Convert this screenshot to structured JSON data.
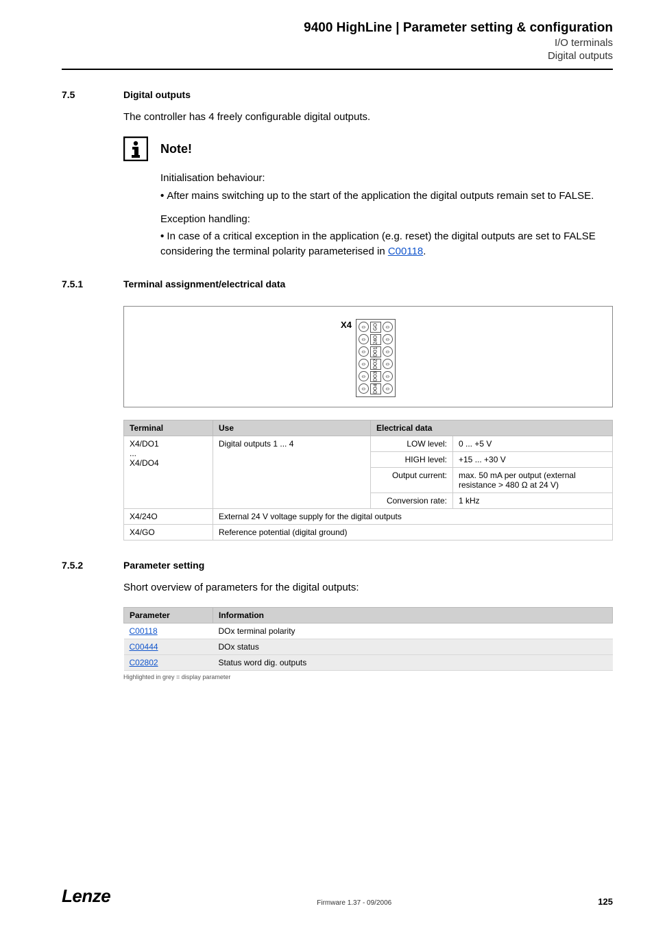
{
  "header": {
    "title": "9400 HighLine | Parameter setting & configuration",
    "sub1": "I/O terminals",
    "sub2": "Digital outputs"
  },
  "sec75": {
    "num": "7.5",
    "title": "Digital outputs",
    "intro": "The controller has 4 freely configurable digital outputs."
  },
  "note": {
    "label": "Note!",
    "p1": "Initialisation behaviour:",
    "b1": "After mains switching up to the start of the application the digital outputs remain set to FALSE.",
    "p2": "Exception handling:",
    "b2a": "In case of a critical exception in the application (e.g. reset) the digital outputs are set to FALSE considering the terminal polarity parameterised in ",
    "b2link": "C00118",
    "b2b": "."
  },
  "sec751": {
    "num": "7.5.1",
    "title": "Terminal assignment/electrical data"
  },
  "terminal": {
    "x4": "X4",
    "pins": [
      "GO",
      "24O",
      "DO1",
      "DO2",
      "DO3",
      "DO4"
    ]
  },
  "table1": {
    "h1": "Terminal",
    "h2": "Use",
    "h3": "Electrical data",
    "r1c1a": "X4/DO1",
    "r1c1b": "...",
    "r1c1c": "X4/DO4",
    "r1c2": "Digital outputs 1 ... 4",
    "e1k": "LOW level:",
    "e1v": "0 ... +5 V",
    "e2k": "HIGH level:",
    "e2v": "+15 ... +30 V",
    "e3k": "Output current:",
    "e3v": "max. 50 mA per output (external resistance > 480 Ω at 24 V)",
    "e4k": "Conversion rate:",
    "e4v": "1 kHz",
    "r2c1": "X4/24O",
    "r2c2": "External 24 V voltage supply for the digital outputs",
    "r3c1": "X4/GO",
    "r3c2": "Reference potential (digital ground)"
  },
  "sec752": {
    "num": "7.5.2",
    "title": "Parameter setting",
    "intro": "Short overview of parameters for the digital outputs:"
  },
  "table2": {
    "h1": "Parameter",
    "h2": "Information",
    "r1p": "C00118",
    "r1i": "DOx terminal polarity",
    "r2p": "C00444",
    "r2i": "DOx status",
    "r3p": "C02802",
    "r3i": "Status word dig. outputs",
    "foot": "Highlighted in grey = display parameter"
  },
  "footer": {
    "brand": "Lenze",
    "firmware": "Firmware 1.37 - 09/2006",
    "page": "125"
  }
}
